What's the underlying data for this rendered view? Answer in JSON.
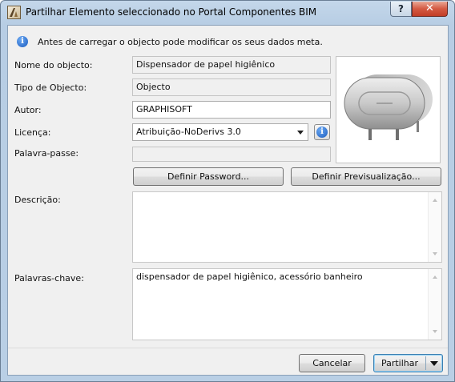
{
  "window": {
    "title": "Partilhar Elemento seleccionado no Portal Componentes BIM",
    "help_label": "?",
    "close_label": "✕"
  },
  "info_message": "Antes de carregar o objecto pode modificar os seus dados meta.",
  "form": {
    "name_label": "Nome do objecto:",
    "name_value": "Dispensador de papel higiênico",
    "type_label": "Tipo de Objecto:",
    "type_value": "Objecto",
    "author_label": "Autor:",
    "author_value": "GRAPHISOFT",
    "license_label": "Licença:",
    "license_value": "Atribuição-NoDerivs 3.0",
    "password_label": "Palavra-passe:",
    "password_value": "",
    "description_label": "Descrição:",
    "description_value": "",
    "keywords_label": "Palavras-chave:",
    "keywords_value": "dispensador de papel higiênico, acessório banheiro"
  },
  "buttons": {
    "set_password": "Definir Password...",
    "set_preview": "Definir Previsualização...",
    "cancel": "Cancelar",
    "share": "Partilhar"
  },
  "icons": {
    "info": "info-icon",
    "license_info": "info-icon",
    "app": "archicad-icon",
    "dropdown": "chevron-down-icon"
  },
  "colors": {
    "title_bar": "#b9cfe5",
    "close_button": "#c8452d",
    "info_blue": "#1c5dc0",
    "dialog_bg": "#f0f0f0"
  }
}
